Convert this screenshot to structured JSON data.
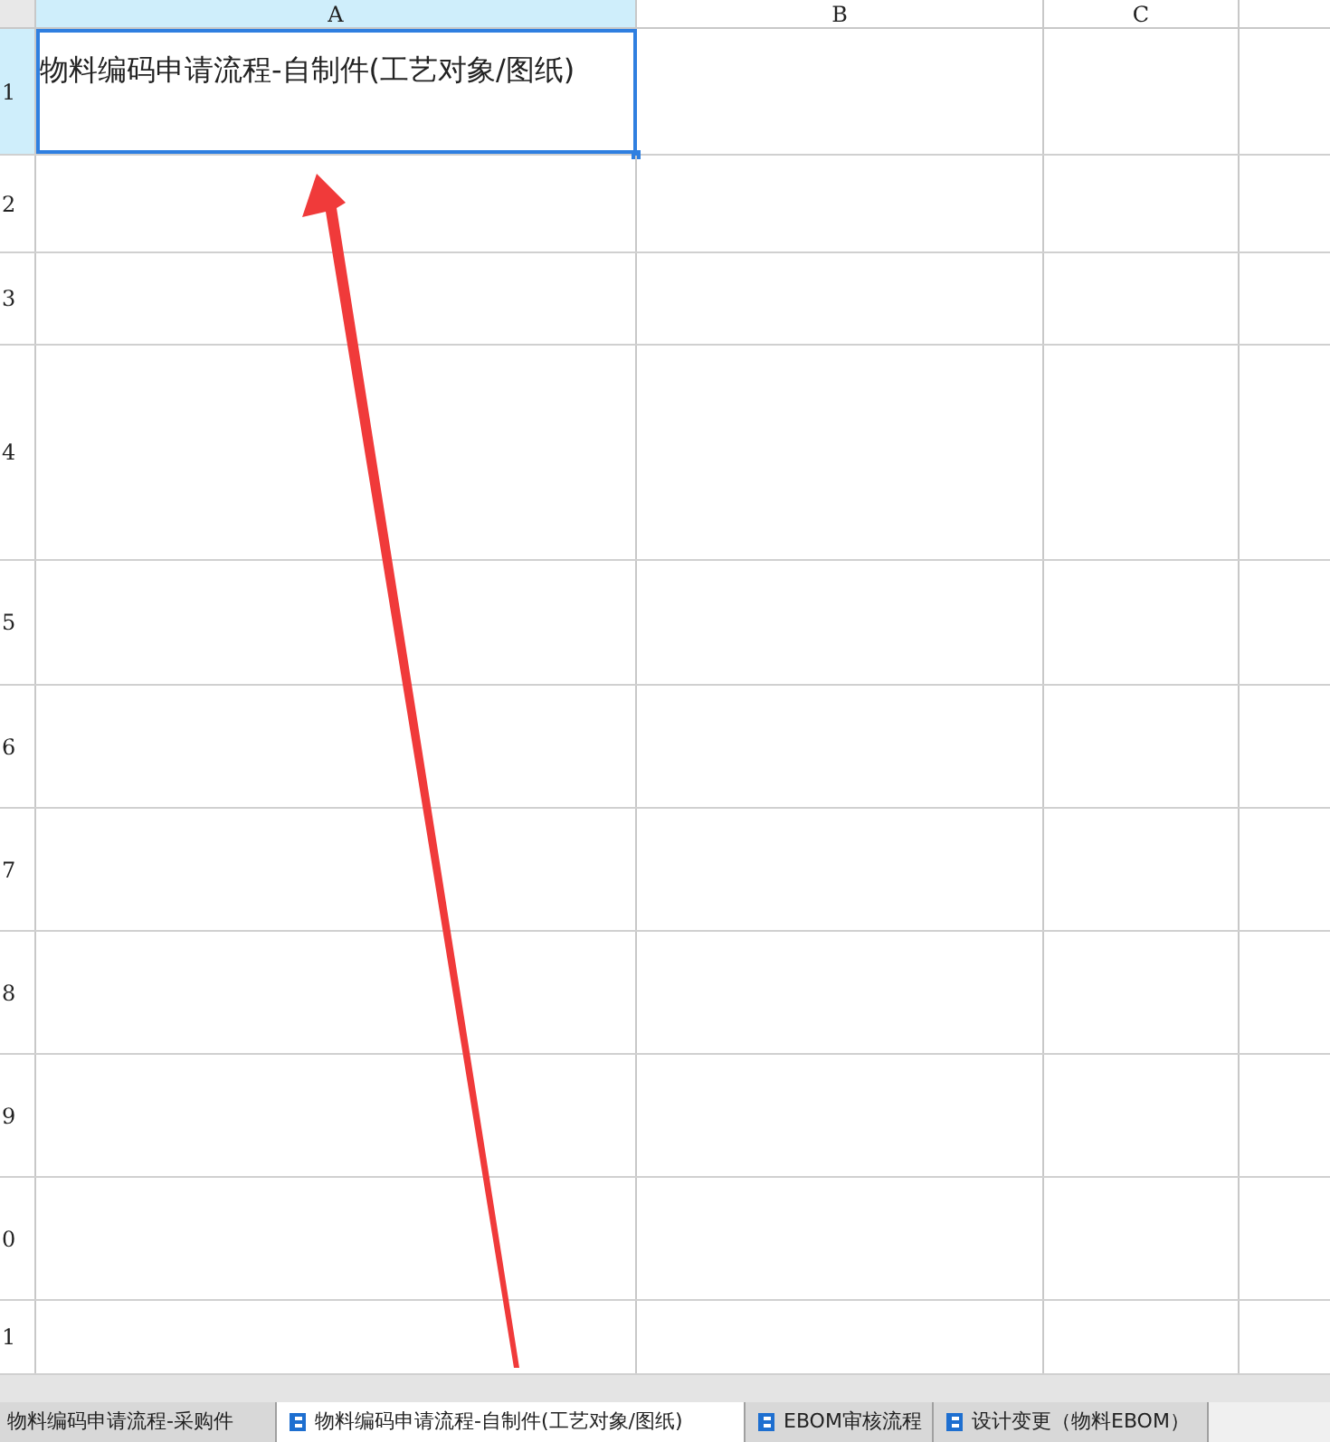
{
  "columns": [
    {
      "label": "A",
      "selected": true
    },
    {
      "label": "B",
      "selected": false
    },
    {
      "label": "C",
      "selected": false
    },
    {
      "selected": false
    }
  ],
  "rows": [
    {
      "number": "1",
      "cells": [
        "物料编码申请流程-自制件(工艺对象/图纸)"
      ],
      "selected": true
    },
    {
      "number": "2",
      "selected": false
    },
    {
      "number": "3",
      "selected": false
    },
    {
      "number": "4",
      "selected": false
    },
    {
      "number": "5",
      "selected": false
    },
    {
      "number": "6",
      "selected": false
    },
    {
      "number": "7",
      "selected": false
    },
    {
      "number": "8",
      "selected": false
    },
    {
      "number": "9",
      "selected": false
    },
    {
      "number": "0",
      "selected": false
    },
    {
      "number": "1",
      "selected": false
    }
  ],
  "sheet_tabs": [
    {
      "label": "物料编码申请流程-采购件",
      "selected": false,
      "has_icon": false
    },
    {
      "label": "物料编码申请流程-自制件(工艺对象/图纸)",
      "selected": true,
      "has_icon": true
    },
    {
      "label": "EBOM审核流程",
      "selected": false,
      "has_icon": true
    },
    {
      "label": "设计变更（物料EBOM）",
      "selected": false,
      "has_icon": true
    }
  ]
}
